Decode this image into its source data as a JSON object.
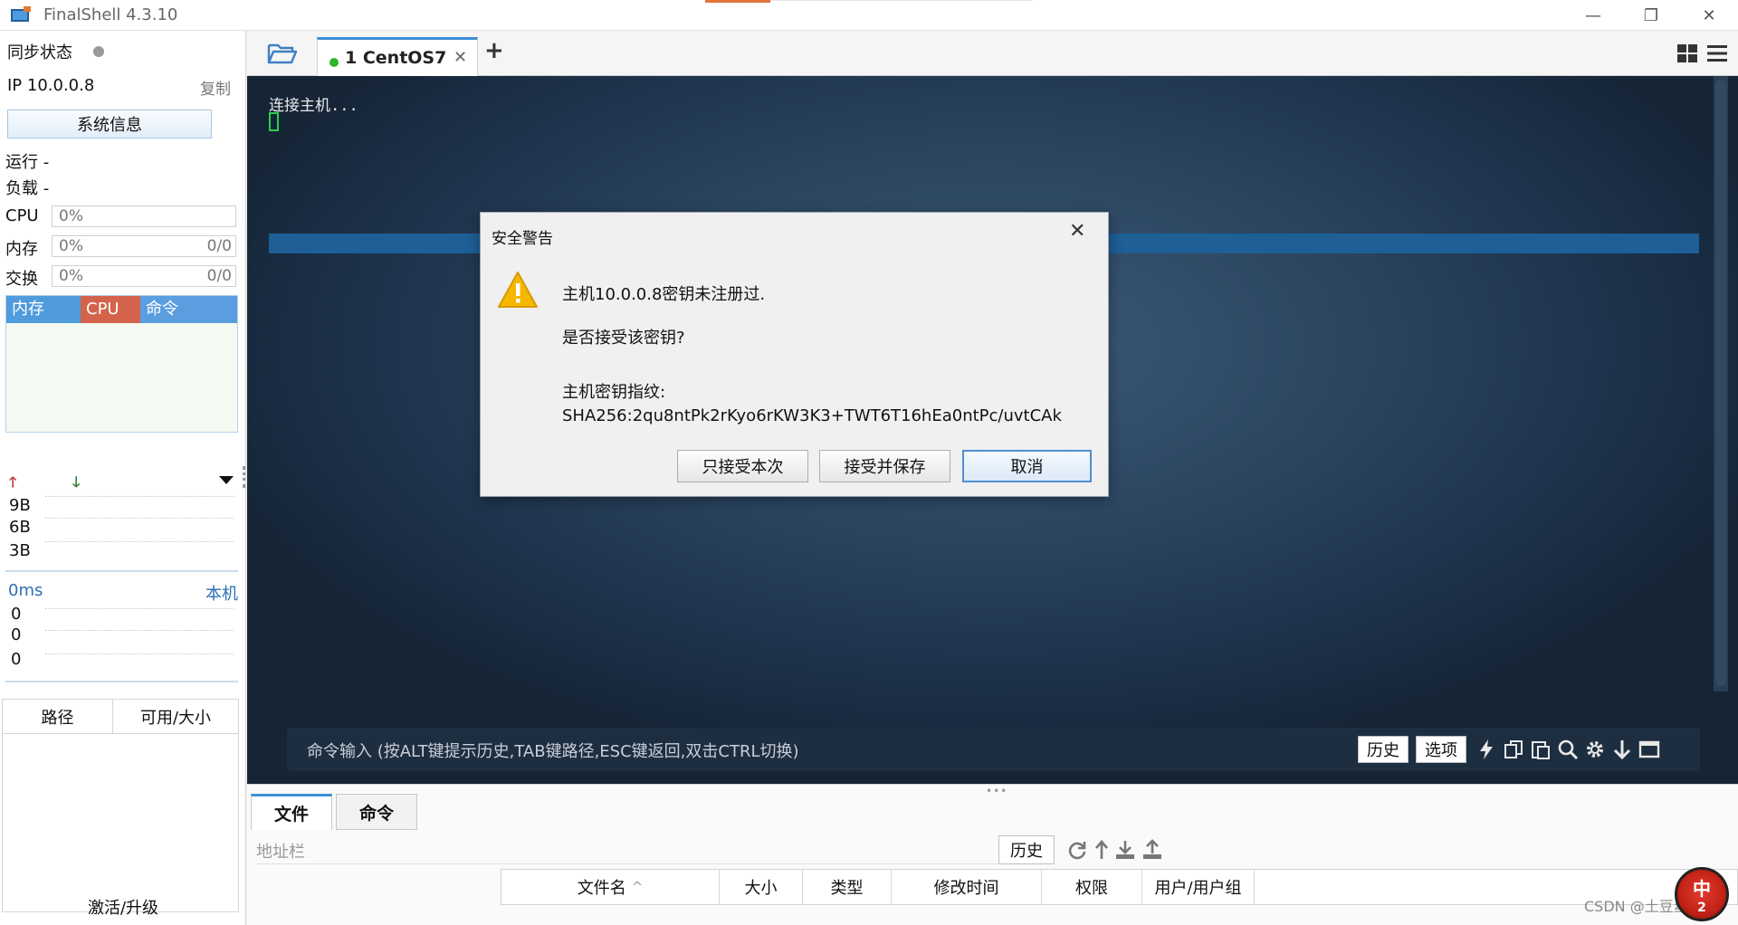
{
  "window": {
    "title": "FinalShell 4.3.10",
    "minimize_glyph": "—",
    "maximize_glyph": "❐",
    "close_glyph": "✕"
  },
  "left": {
    "sync_label": "同步状态",
    "ip_label": "IP  10.0.0.8",
    "copy_label": "复制",
    "sysinfo_button": "系统信息",
    "run_label": "运行 -",
    "load_label": "负载 -",
    "cpu": {
      "label": "CPU",
      "percent": "0%"
    },
    "mem": {
      "label": "内存",
      "percent": "0%",
      "ratio": "0/0"
    },
    "swap": {
      "label": "交换",
      "percent": "0%",
      "ratio": "0/0"
    },
    "process_table": {
      "col_mem": "内存",
      "col_cpu": "CPU",
      "col_cmd": "命令"
    },
    "network": {
      "up_arrow": "🡑",
      "down_arrow": "🡓",
      "levels": [
        "9B",
        "6B",
        "3B"
      ]
    },
    "ping": {
      "latency": "0ms",
      "target": "本机",
      "values": [
        "0",
        "0",
        "0"
      ]
    },
    "disk": {
      "col_path": "路径",
      "col_size": "可用/大小"
    },
    "upgrade_label": "激活/升级"
  },
  "tabs": {
    "session_tab": "1 CentOS7",
    "close_glyph": "✕",
    "add_glyph": "+"
  },
  "terminal": {
    "connecting_text": "连接主机...",
    "command_hint": "命令输入 (按ALT键提示历史,TAB键路径,ESC键返回,双击CTRL切换)",
    "history_button": "历史",
    "options_button": "选项",
    "icons": [
      "lightning-icon",
      "copy-icon",
      "paste-icon",
      "search-icon",
      "gear-icon",
      "arrow-down-icon",
      "window-icon"
    ]
  },
  "bottom": {
    "tab_files": "文件",
    "tab_commands": "命令",
    "address_placeholder": "地址栏",
    "history_button": "历史",
    "columns": [
      "文件名",
      "大小",
      "类型",
      "修改时间",
      "权限",
      "用户/用户组"
    ],
    "sort_glyph": "^"
  },
  "dialog": {
    "title": "安全警告",
    "close_glyph": "✕",
    "line1": "主机10.0.0.8密钥未注册过.",
    "line2": "是否接受该密钥?",
    "line3": "主机密钥指纹:",
    "fingerprint": "SHA256:2qu8ntPk2rKyo6rKW3K3+TWT6T16hEa0ntPc/uvtCAk",
    "btn_once": "只接受本次",
    "btn_save": "接受并保存",
    "btn_cancel": "取消"
  },
  "overlay": {
    "watermark": "CSDN @土豆丝影",
    "ime_char": "中",
    "ime_sub": "2"
  }
}
